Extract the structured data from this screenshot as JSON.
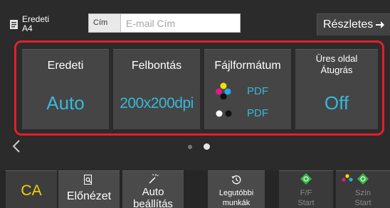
{
  "header": {
    "original_label": "Eredeti",
    "original_size": "A4",
    "address_tag": "Cím",
    "address_placeholder": "E-mail Cím",
    "details_label": "Részletes"
  },
  "settings": [
    {
      "title": "Eredeti",
      "value": "Auto"
    },
    {
      "title": "Felbontás",
      "value": "200x200dpi"
    },
    {
      "title": "Fájlformátum",
      "value_color": "PDF",
      "value_mono": "PDF"
    },
    {
      "title_line1": "Üres oldal",
      "title_line2": "Átugrás",
      "value": "Off"
    }
  ],
  "pager": {
    "pages": 2,
    "current": 2
  },
  "bottom": {
    "ca": "CA",
    "preview": "Előnézet",
    "auto_line1": "Auto",
    "auto_line2": "beállítás",
    "recent_line1": "Legutóbbi",
    "recent_line2": "munkák",
    "bw_line1": "F/F",
    "bw_line2": "Start",
    "color_line1": "Szín",
    "color_line2": "Start"
  },
  "colors": {
    "accent": "#39b8d8",
    "highlight_border": "#e61e2a",
    "ca_text": "#f0d400",
    "start_green": "#39b54a"
  }
}
